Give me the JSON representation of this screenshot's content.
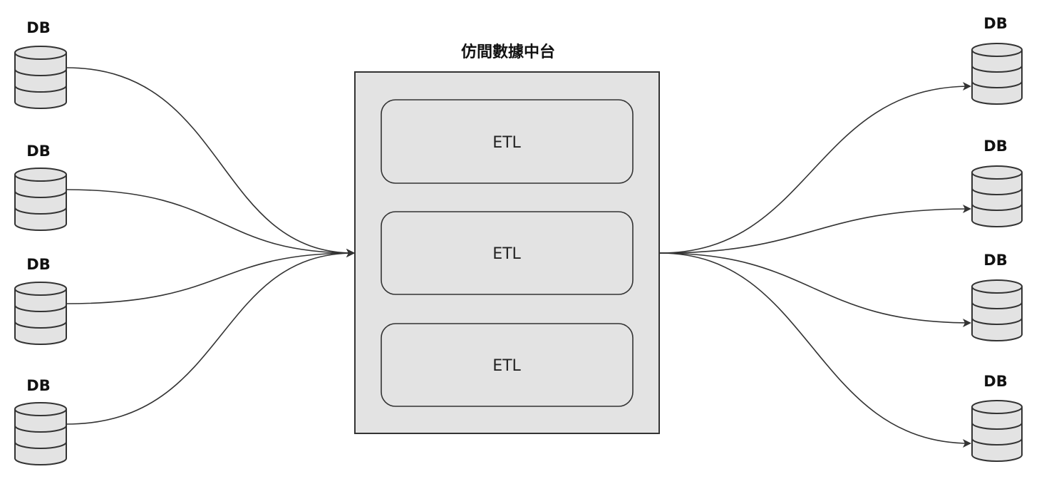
{
  "hub": {
    "title": "仿間數據中台",
    "etl_blocks": [
      {
        "label": "ETL"
      },
      {
        "label": "ETL"
      },
      {
        "label": "ETL"
      }
    ]
  },
  "sources": [
    {
      "label": "DB"
    },
    {
      "label": "DB"
    },
    {
      "label": "DB"
    },
    {
      "label": "DB"
    }
  ],
  "targets": [
    {
      "label": "DB"
    },
    {
      "label": "DB"
    },
    {
      "label": "DB"
    },
    {
      "label": "DB"
    }
  ],
  "colors": {
    "background": "#ffffff",
    "node_fill": "#e3e3e3",
    "stroke": "#333333",
    "text": "#111111"
  },
  "icons": {
    "database": "database-icon"
  }
}
